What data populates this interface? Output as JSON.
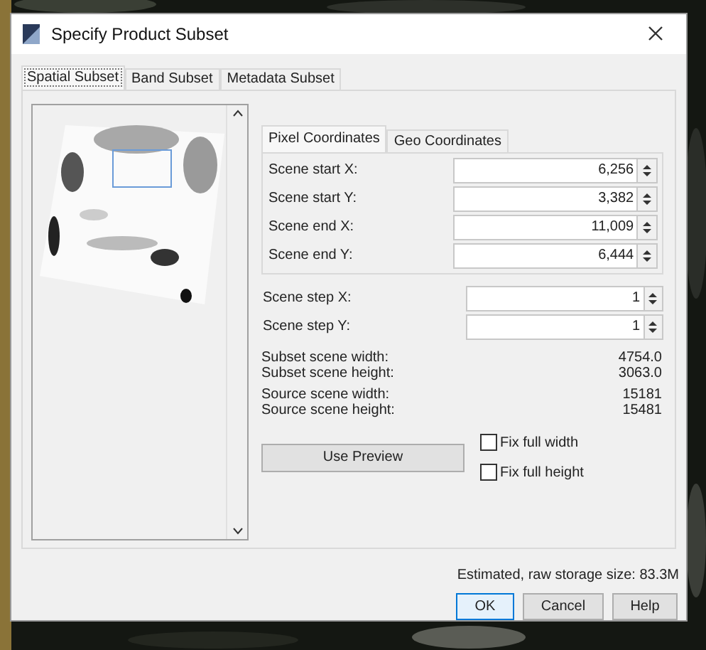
{
  "window": {
    "title": "Specify Product Subset"
  },
  "tabs": [
    {
      "label": "Spatial Subset",
      "selected": true
    },
    {
      "label": "Band Subset",
      "selected": false
    },
    {
      "label": "Metadata Subset",
      "selected": false
    }
  ],
  "coordinate_tabs": [
    {
      "label": "Pixel Coordinates",
      "selected": true
    },
    {
      "label": "Geo Coordinates",
      "selected": false
    }
  ],
  "coordinate_fields": [
    {
      "label": "Scene start X:",
      "value": "6,256"
    },
    {
      "label": "Scene start Y:",
      "value": "3,382"
    },
    {
      "label": "Scene end X:",
      "value": "11,009"
    },
    {
      "label": "Scene end Y:",
      "value": "6,444"
    }
  ],
  "step_fields": [
    {
      "label": "Scene step X:",
      "value": "1"
    },
    {
      "label": "Scene step Y:",
      "value": "1"
    }
  ],
  "subset_info": [
    {
      "label": "Subset scene width:",
      "value": "4754.0"
    },
    {
      "label": "Subset scene height:",
      "value": "3063.0"
    }
  ],
  "source_info": [
    {
      "label": "Source scene width:",
      "value": "15181"
    },
    {
      "label": "Source scene height:",
      "value": "15481"
    }
  ],
  "use_preview_button": "Use Preview",
  "checkboxes": [
    {
      "label": "Fix full width",
      "checked": false
    },
    {
      "label": "Fix full height",
      "checked": false
    }
  ],
  "storage_estimate": "Estimated, raw storage size: 83.3M",
  "buttons": [
    {
      "label": "OK",
      "default": true
    },
    {
      "label": "Cancel",
      "default": false
    },
    {
      "label": "Help",
      "default": false
    }
  ]
}
